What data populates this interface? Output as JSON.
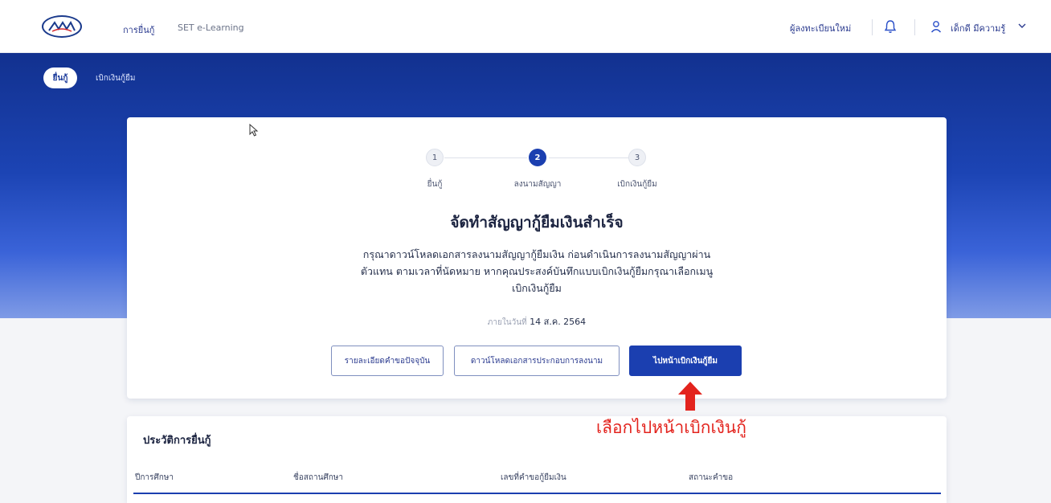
{
  "header": {
    "nav": [
      "การยื่นกู้",
      "SET e-Learning"
    ],
    "register_label": "ผู้ลงทะเบียนใหม่",
    "user_name": "เด็กดี มีความรู้"
  },
  "breadcrumb": {
    "pill_label": "ยื่นกู้",
    "link_label": "เบิกเงินกู้ยืม"
  },
  "stepper": {
    "steps": [
      {
        "number": "1",
        "label": "ยื่นกู้",
        "active": false
      },
      {
        "number": "2",
        "label": "ลงนามสัญญา",
        "active": true
      },
      {
        "number": "3",
        "label": "เบิกเงินกู้ยืม",
        "active": false
      }
    ]
  },
  "main": {
    "title": "จัดทำสัญญากู้ยืมเงินสำเร็จ",
    "description_lines": [
      "กรุณาดาวน์โหลดเอกสารลงนามสัญญากู้ยืมเงิน ก่อนดำเนินการลงนามสัญญาผ่าน",
      "ตัวแทน ตามเวลาที่นัดหมาย หากคุณประสงค์บันทึกแบบเบิกเงินกู้ยืมกรุณาเลือกเมนู",
      "เบิกเงินกู้ยืม"
    ],
    "date_label": "ภายในวันที่",
    "date_value": "14 ส.ค. 2564",
    "buttons": {
      "details": "รายละเอียดคำขอปัจจุบัน",
      "download": "ดาวน์โหลดเอกสารประกอบการลงนาม",
      "go_disburse": "ไปหน้าเบิกเงินกู้ยืม"
    }
  },
  "annotation": {
    "text": "เลือกไปหน้าเบิกเงินกู้",
    "color": "#e3231d"
  },
  "history": {
    "title": "ประวัติการยื่นกู้",
    "columns": [
      "ปีการศึกษา",
      "ชื่อสถานศึกษา",
      "เลขที่คำขอกู้ยืมเงิน",
      "สถานะคำขอ"
    ]
  },
  "colors": {
    "primary": "#1b3fb0",
    "banner": "#12318f"
  }
}
